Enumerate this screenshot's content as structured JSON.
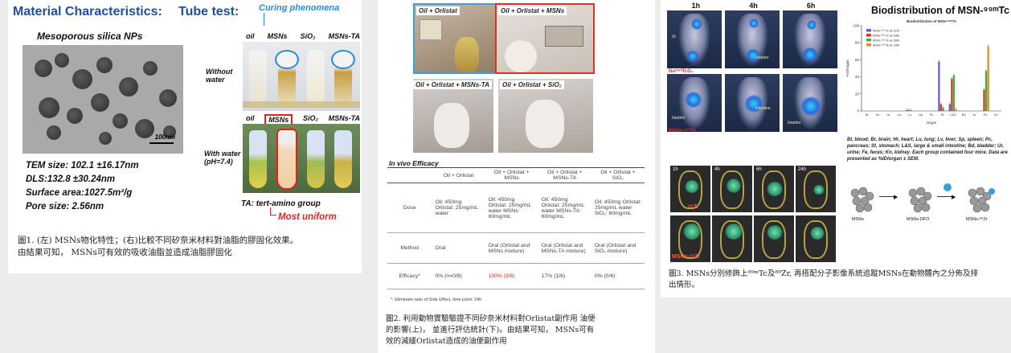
{
  "panel1": {
    "title": "Material Characteristics:",
    "tube_test": "Tube test:",
    "curing": "Curing phenomena",
    "tem_title": "Mesoporous silica NPs",
    "scale_bar": "100nm",
    "props": [
      "TEM size: 102.1 ±16.17nm",
      "DLS:132.8 ±30.24nm",
      "Surface area:1027.5m²/g",
      "Pore size: 2.56nm"
    ],
    "tube_labels_top": [
      "oil",
      "MSNs",
      "SiO₂",
      "MSNs-TA"
    ],
    "tube_labels_bottom": [
      "oil",
      "MSNs",
      "SiO₂",
      "MSNs-TA"
    ],
    "without_water": "Without water",
    "with_water": "With water (pH=7.4)",
    "ta_note": "TA: tert-amino group",
    "most_uniform": "Most uniform",
    "caption_line1": "圖1. (左) MSNs物化特性；(右)比較不同矽奈米材料對油脂的膠固化效果。",
    "caption_line2": "由結果可知， MSNs可有效的吸收油脂並造成油脂膠固化"
  },
  "panel2": {
    "photo_labels": [
      "Oil + Orlistat",
      "Oil + Orlistat + MSNs",
      "Oil + Orlistat + MSNs-TA",
      "Oil + Orlistat + SiO₂"
    ],
    "table_title": "In vivo Efficacy",
    "headers": [
      "",
      "Oil + Orlistat",
      "Oil + Orlistat + MSNs",
      "Oil + Orlistat + MSNs-TA",
      "Oil + Orlistat + SiO₂"
    ],
    "dose_label": "Dose",
    "dose": [
      "Oil: 450mg Orlistat: 25mg/mL water",
      "Oil: 450mg Orlistat: 25mg/mL water MSNs: 60mg/mL",
      "Oil: 450mg Orlistat: 25mg/mL water MSNs-TA: 60mg/mL",
      "Oil: 450mg Orlistat: 25mg/mL water SiO₂: 60mg/mL"
    ],
    "method_label": "Method",
    "method": [
      "Oral",
      "Oral (Orlistat and MSNs mixture)",
      "Oral (Orlistat and MSNs-TA mixture)",
      "Oral (Orlistat and SiO₂ mixture)"
    ],
    "efficacy_label": "Efficacy*",
    "efficacy": [
      "0% (n=0/8)",
      "100% (8/8)",
      "17% (1/6)",
      "0% (0/6)"
    ],
    "footnote": "*: Eliminate ratio of Side Effect, time point: 24h",
    "caption_line1": "圖2. 利用動物實驗驗證不同矽奈米材料對Orlistat副作用 油便",
    "caption_line2": "的影響(上)， 並進行評估統計(下)。由結果可知， MSNs可有",
    "caption_line3": "效的減緩Orlistat造成的油便副作用"
  },
  "panel3": {
    "times": [
      "1h",
      "4h",
      "6h"
    ],
    "row1_label": "Na⁹⁹ᵐTcO₄",
    "row2_label": "MSNs-⁹⁹ᵐTc",
    "organ_tags": [
      "St",
      "bladder",
      "intestine",
      "bladder",
      "bladder"
    ],
    "bio_title": "Biodistribution of MSN-⁹⁹ᵐTc",
    "legend": [
      "MSN-⁹⁹ᵐTc at 01hr",
      "MSN-⁹⁹ᵐTc at 04hr",
      "MSN-⁹⁹ᵐTc at 06hr",
      "MSN-⁹⁹ᵐTc at 24hr"
    ],
    "bio_note": "Bl, blood; Br, brain; Hr, heart; Lu, lung; Lv, liver; Sp, spleen; Pc, pancreas; St, stomach; L&S, large & small intestine; Bd, bladder; Ur, urine; Fe, feces; Kn, kidney. Each group contained four mice. Data are presented as %ID/organ ± SEM.",
    "pet_times": [
      "1h",
      "4h",
      "6h",
      "24h"
    ],
    "pet_row1": "⁸⁹Zr",
    "pet_row2": "MSNs-⁸⁹Zr",
    "scheme": [
      "MSNs",
      "MSNs-DFO",
      "MSNs-⁸⁹Zr"
    ],
    "caption_line1": "圖3. MSNs分別修飾上⁹⁹ᵐTc及⁸⁹Zr, 再搭配分子影像系統追蹤MSNs在動物體內之分佈及排",
    "caption_line2": "出情形。"
  },
  "chart_data": {
    "type": "bar",
    "title": "Biodistribution of MSN-⁹⁹ᵐTc",
    "xlabel": "Organ",
    "ylabel": "%ID/organ",
    "categories": [
      "Bl",
      "Br",
      "Hr",
      "Lu",
      "Lv",
      "Sp",
      "Pc",
      "St",
      "L&S",
      "Bd",
      "Ur",
      "Fe",
      "Kn"
    ],
    "ylim": [
      0,
      100
    ],
    "series": [
      {
        "name": "MSN-⁹⁹ᵐTc at 01hr",
        "color": "#6b5bd6",
        "values": [
          0,
          0,
          0,
          0,
          1,
          0,
          0,
          58,
          8,
          0,
          0,
          0,
          0
        ]
      },
      {
        "name": "MSN-⁹⁹ᵐTc at 04hr",
        "color": "#d9382e",
        "values": [
          0,
          0,
          0,
          0,
          1,
          0,
          0,
          8,
          38,
          0,
          0,
          25,
          0
        ]
      },
      {
        "name": "MSN-⁹⁹ᵐTc at 06hr",
        "color": "#3db04a",
        "values": [
          0,
          0,
          0,
          0,
          1,
          0,
          0,
          4,
          42,
          0,
          0,
          47,
          0
        ]
      },
      {
        "name": "MSN-⁹⁹ᵐTc at 24hr",
        "color": "#e8892a",
        "values": [
          0,
          0,
          0,
          0,
          0,
          0,
          0,
          0,
          2,
          0,
          0,
          76,
          0
        ]
      }
    ]
  }
}
